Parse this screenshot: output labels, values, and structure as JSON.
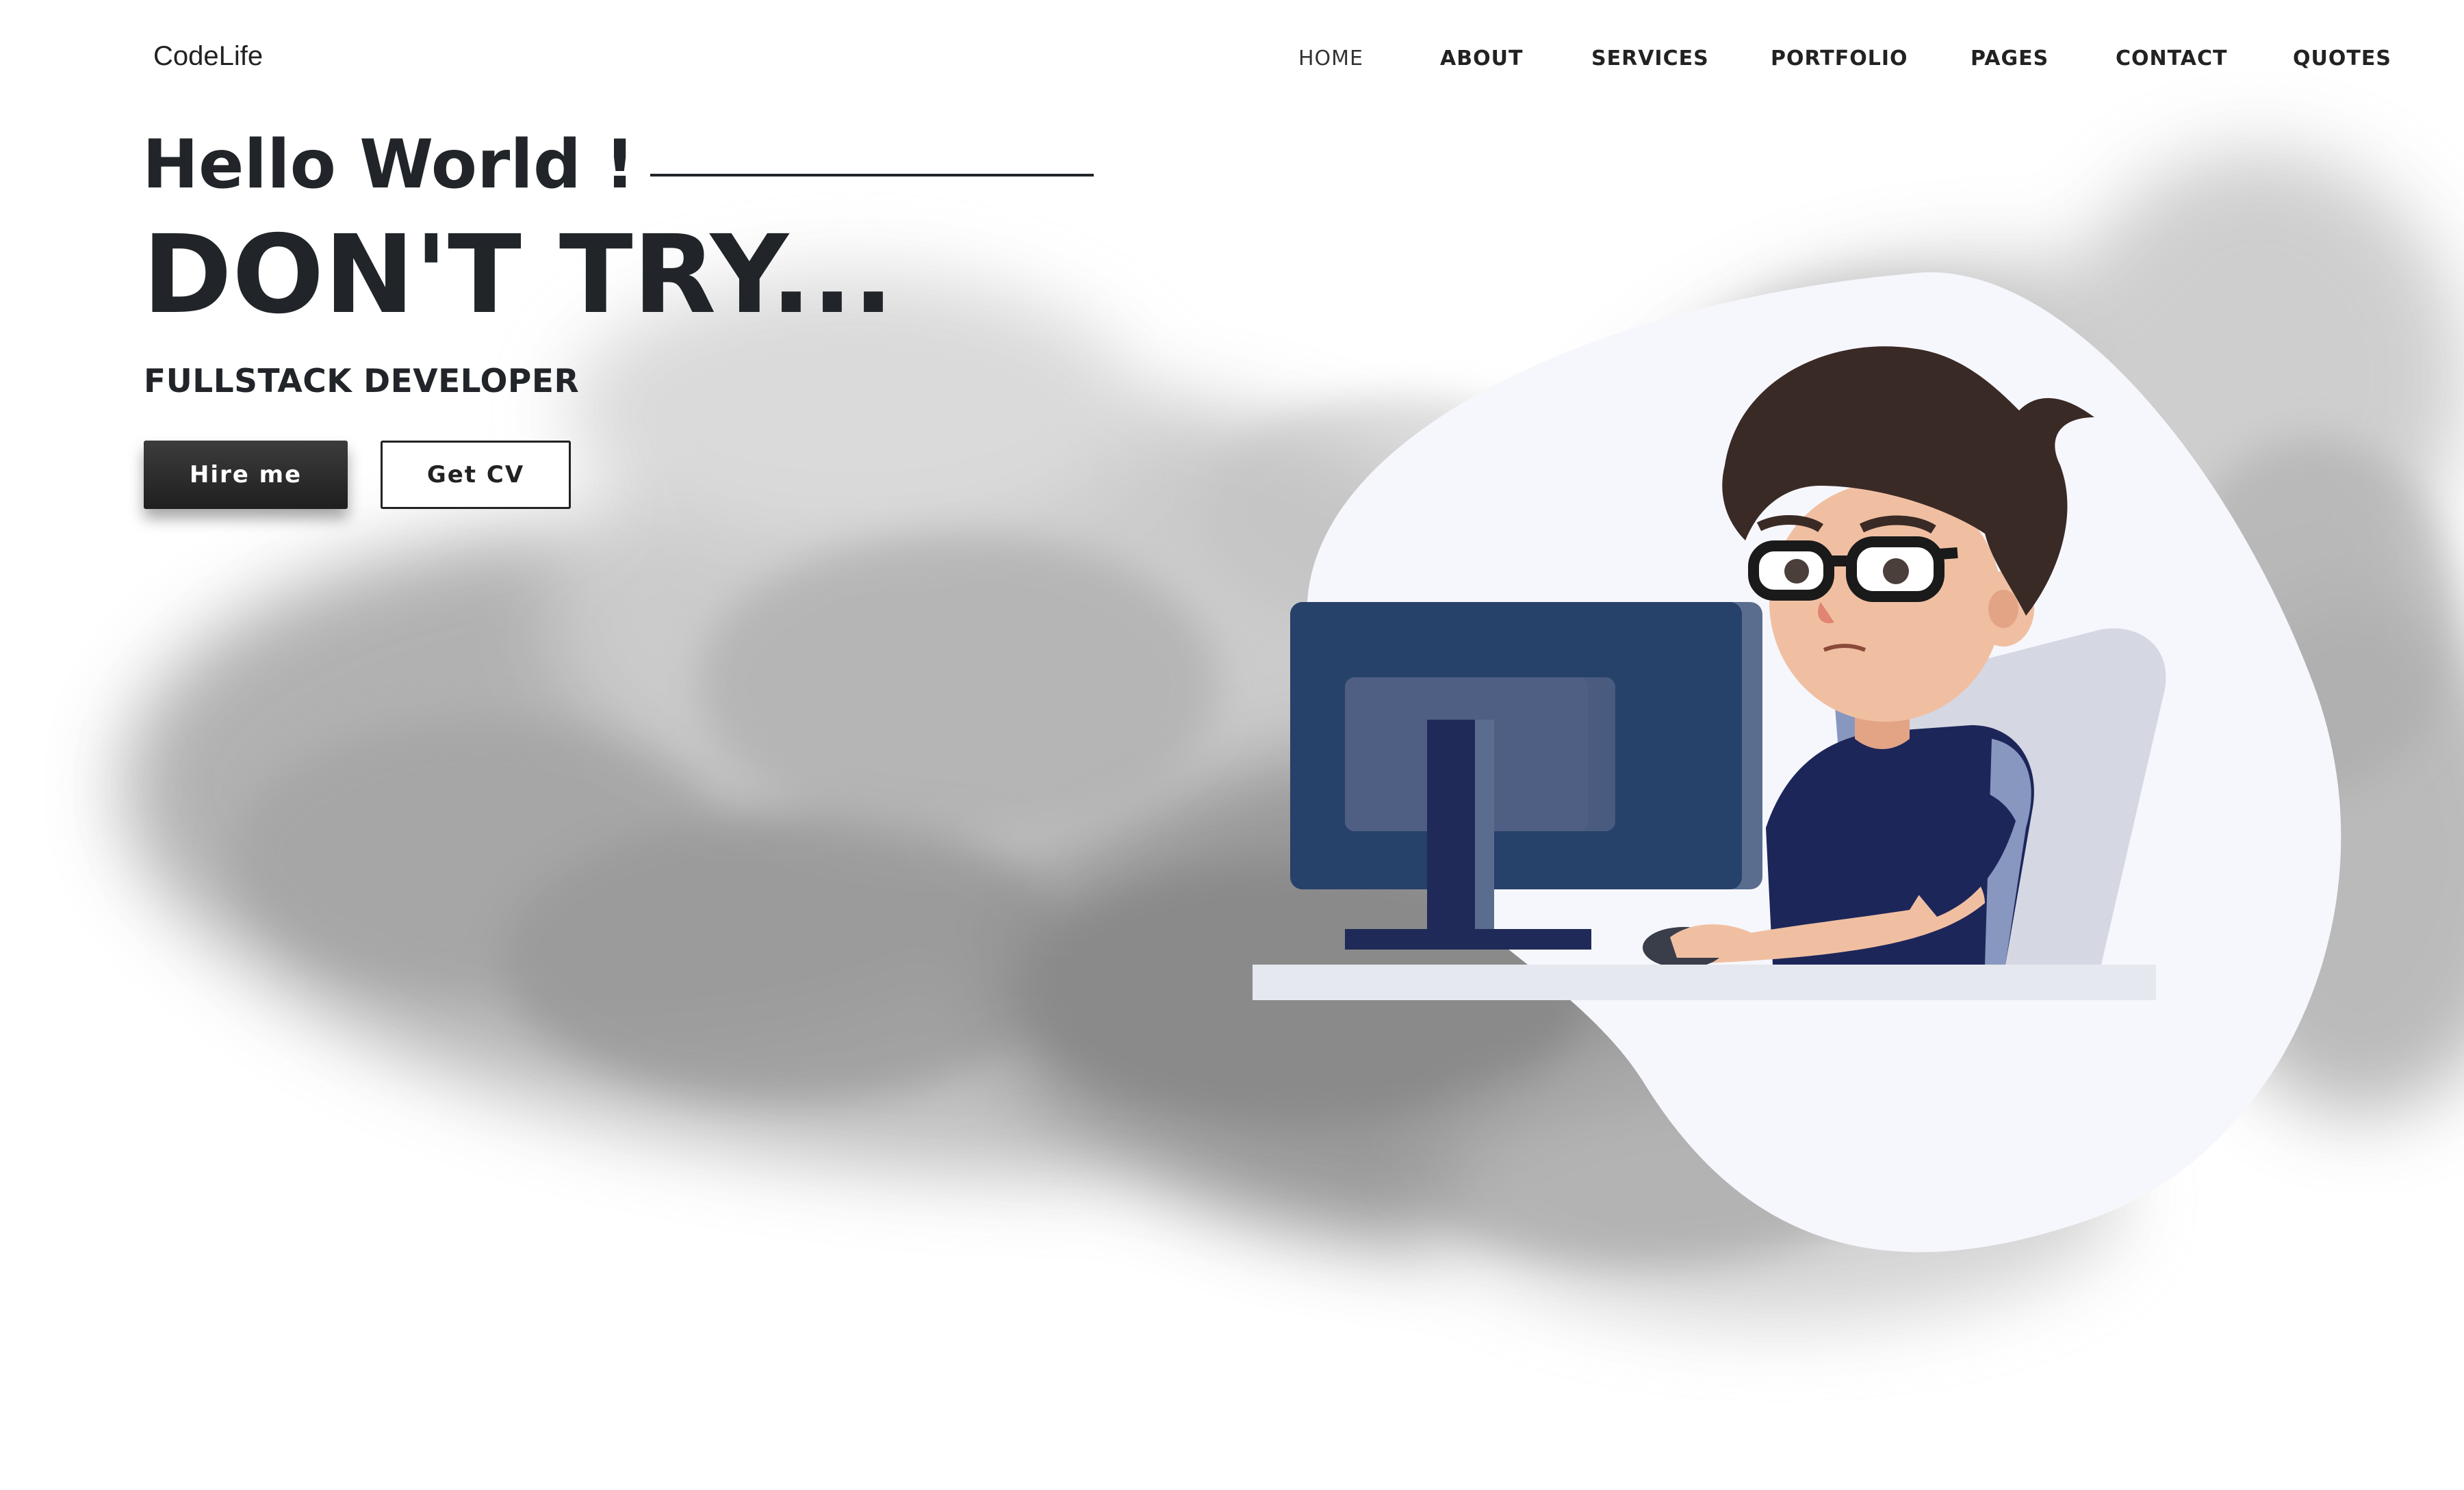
{
  "brand": {
    "name": "CodeLife"
  },
  "nav": {
    "items": [
      {
        "label": "HOME",
        "active": true
      },
      {
        "label": "ABOUT",
        "active": false
      },
      {
        "label": "SERVICES",
        "active": false
      },
      {
        "label": "PORTFOLIO",
        "active": false
      },
      {
        "label": "PAGES",
        "active": false
      },
      {
        "label": "CONTACT",
        "active": false
      },
      {
        "label": "QUOTES",
        "active": false
      }
    ]
  },
  "hero": {
    "greeting": "Hello World !",
    "headline": "DON'T TRY...",
    "role": "FULLSTACK DEVELOPER",
    "primary_button": "Hire me",
    "secondary_button": "Get CV"
  },
  "illustration": {
    "subject": "developer-at-computer",
    "colors": {
      "blob": "#f6f7fc",
      "monitor": "#26416a",
      "shirt": "#1d2659",
      "hair": "#3a2a26",
      "skin": "#f0bfa2",
      "chair": "#d6d8e4",
      "desk": "#e6e8ef"
    }
  },
  "colors": {
    "text": "#212529",
    "button_dark": "#2d2d2d"
  }
}
